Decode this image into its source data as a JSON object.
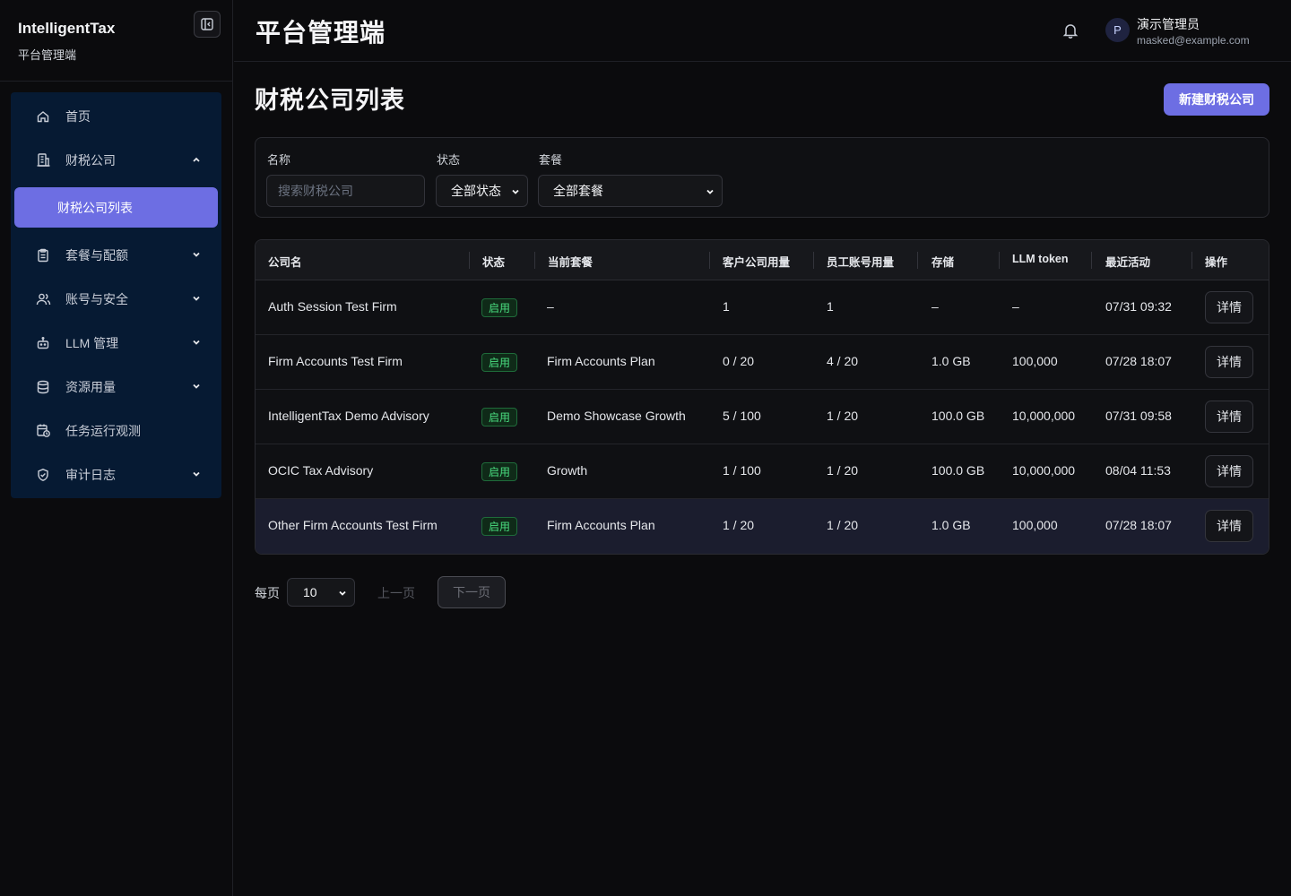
{
  "sidebar": {
    "brand_title": "IntelligentTax",
    "brand_subtitle": "平台管理端",
    "items": [
      {
        "label": "首页",
        "icon": "home-icon"
      },
      {
        "label": "财税公司",
        "icon": "building-icon"
      },
      {
        "label": "财税公司列表"
      },
      {
        "label": "套餐与配额",
        "icon": "clipboard-icon"
      },
      {
        "label": "账号与安全",
        "icon": "users-icon"
      },
      {
        "label": "LLM 管理",
        "icon": "robot-icon"
      },
      {
        "label": "资源用量",
        "icon": "database-icon"
      },
      {
        "label": "任务运行观测",
        "icon": "calendar-clock-icon"
      },
      {
        "label": "审计日志",
        "icon": "shield-check-icon"
      }
    ]
  },
  "header": {
    "title": "平台管理端",
    "user_initial": "P",
    "user_name": "演示管理员",
    "user_email": "masked@example.com"
  },
  "main": {
    "title": "财税公司列表",
    "new_button": "新建财税公司",
    "filters": {
      "name_label": "名称",
      "name_placeholder": "搜索财税公司",
      "status_label": "状态",
      "status_value": "全部状态",
      "plan_label": "套餐",
      "plan_value": "全部套餐"
    },
    "table": {
      "headers": [
        "公司名",
        "状态",
        "当前套餐",
        "客户公司用量",
        "员工账号用量",
        "存储",
        "LLM token",
        "最近活动",
        "操作"
      ],
      "rows": [
        {
          "name": "Auth Session Test Firm",
          "status": "启用",
          "plan": "–",
          "client_usage": "1",
          "staff_usage": "1",
          "storage": "–",
          "llm_token": "–",
          "last_active": "07/31 09:32",
          "action": "详情"
        },
        {
          "name": "Firm Accounts Test Firm",
          "status": "启用",
          "plan": "Firm Accounts Plan",
          "client_usage": "0 / 20",
          "staff_usage": "4 / 20",
          "storage": "1.0 GB",
          "llm_token": "100,000",
          "last_active": "07/28 18:07",
          "action": "详情"
        },
        {
          "name": "IntelligentTax Demo Advisory",
          "status": "启用",
          "plan": "Demo Showcase Growth",
          "client_usage": "5 / 100",
          "staff_usage": "1 / 20",
          "storage": "100.0 GB",
          "llm_token": "10,000,000",
          "last_active": "07/31 09:58",
          "action": "详情"
        },
        {
          "name": "OCIC Tax Advisory",
          "status": "启用",
          "plan": "Growth",
          "client_usage": "1 / 100",
          "staff_usage": "1 / 20",
          "storage": "100.0 GB",
          "llm_token": "10,000,000",
          "last_active": "08/04 11:53",
          "action": "详情"
        },
        {
          "name": "Other Firm Accounts Test Firm",
          "status": "启用",
          "plan": "Firm Accounts Plan",
          "client_usage": "1 / 20",
          "staff_usage": "1 / 20",
          "storage": "1.0 GB",
          "llm_token": "100,000",
          "last_active": "07/28 18:07",
          "action": "详情"
        }
      ]
    },
    "pagination": {
      "per_page_label": "每页",
      "per_page_value": "10",
      "prev_label": "上一页",
      "next_label": "下一页"
    }
  },
  "colors": {
    "accent": "#6d6ee3",
    "nav_bg": "#061a33",
    "status_green": "#4ade80"
  }
}
